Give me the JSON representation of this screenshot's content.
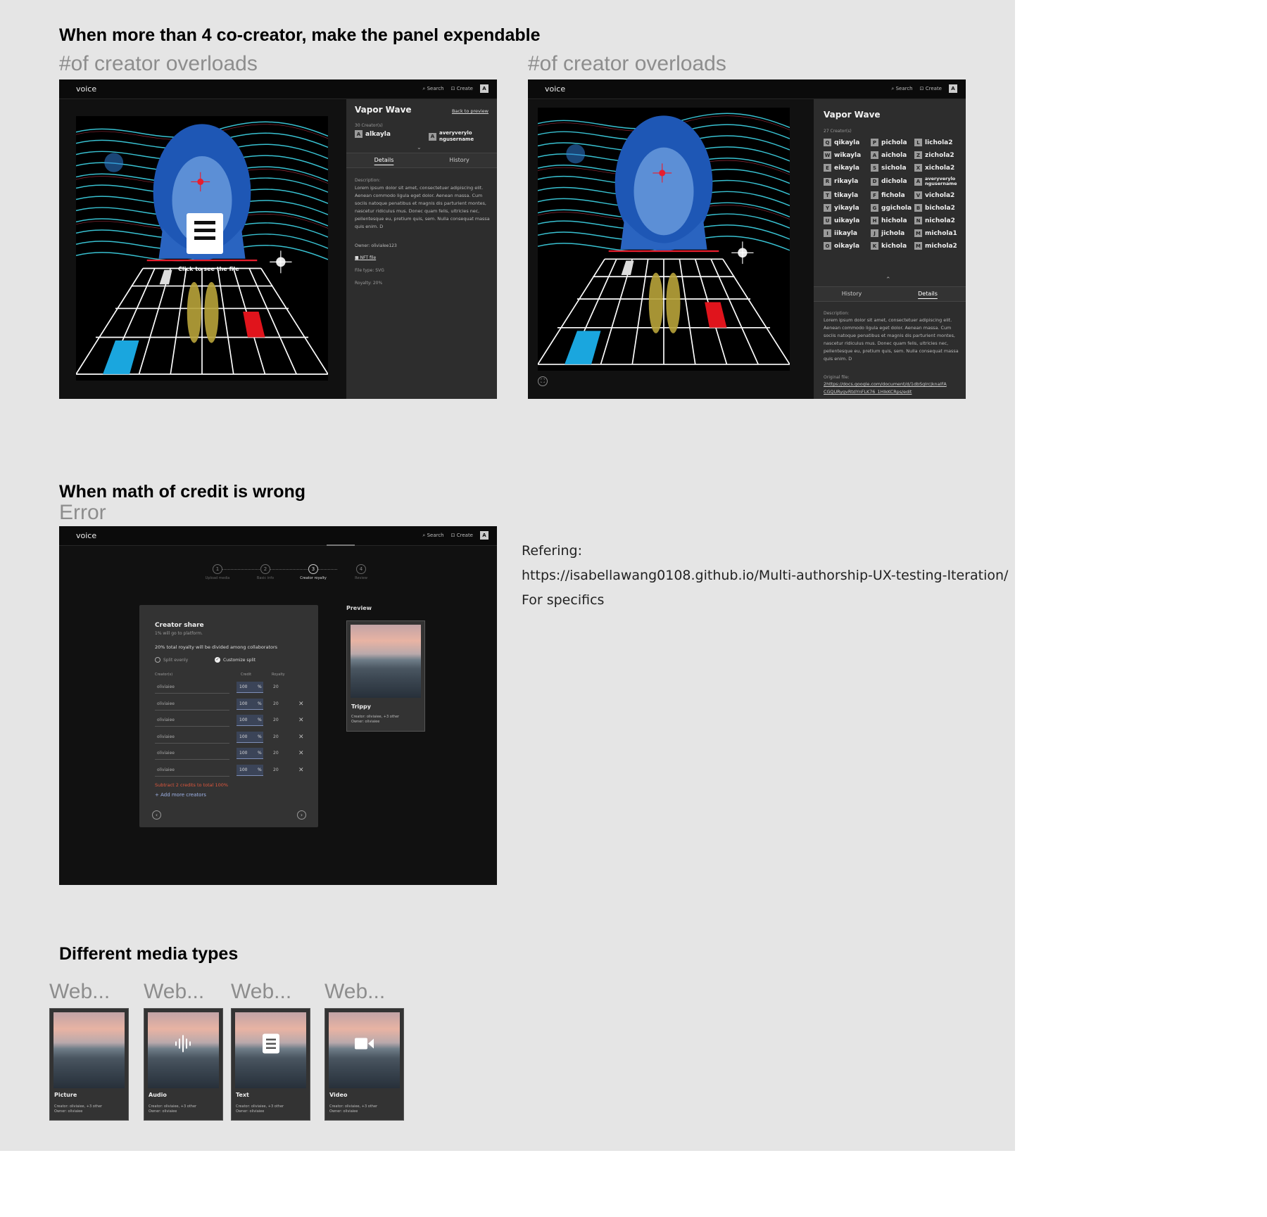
{
  "sections": {
    "expand_title": "When more than 4 co-creator, make the panel expendable",
    "overload_label_1": "#of creator overloads",
    "overload_label_2": "#of creator overloads",
    "error_title": "When math of credit is wrong",
    "error_label": "Error",
    "media_title": "Different media types"
  },
  "app": {
    "logo": "voice",
    "search": "Search",
    "create": "Create",
    "avatar": "A"
  },
  "frame1": {
    "title": "Vapor Wave",
    "back": "Back to preview",
    "creators_count": "30 Creator(s)",
    "creator_a": "alkayla",
    "creator_b": "averyverylo ngusername",
    "tab_details": "Details",
    "tab_history": "History",
    "desc_label": "Description:",
    "desc": "Lorem ipsum dolor sit amet, consectetuer adipiscing elit. Aenean commodo ligula eget dolor. Aenean massa. Cum sociis natoque penatibus et magnis dis parturient montes, nascetur ridiculus mus. Donec quam felis, ultricies nec, pellentesque eu, pretium quis, sem. Nulla consequat massa quis enim. D",
    "owner": "Owner: olivialee123",
    "nft_file": "NFT file",
    "file_type": "File type: SVG",
    "royalty": "Royalty: 20%",
    "overlay_caption": "Click to see the file"
  },
  "frame2": {
    "title": "Vapor Wave",
    "creators_count": "27 Creator(s)",
    "creators": [
      {
        "b": "Q",
        "n": "qikayla"
      },
      {
        "b": "P",
        "n": "pichola"
      },
      {
        "b": "L",
        "n": "lichola2"
      },
      {
        "b": "W",
        "n": "wikayla"
      },
      {
        "b": "A",
        "n": "aichola"
      },
      {
        "b": "Z",
        "n": "zichola2"
      },
      {
        "b": "E",
        "n": "eikayla"
      },
      {
        "b": "S",
        "n": "sichola"
      },
      {
        "b": "X",
        "n": "xichola2"
      },
      {
        "b": "R",
        "n": "rikayla"
      },
      {
        "b": "D",
        "n": "dichola"
      },
      {
        "b": "A",
        "n": "averyverylo ngusername"
      },
      {
        "b": "T",
        "n": "tikayla"
      },
      {
        "b": "F",
        "n": "fichola"
      },
      {
        "b": "V",
        "n": "vichola2"
      },
      {
        "b": "Y",
        "n": "yikayla"
      },
      {
        "b": "G",
        "n": "ggichola"
      },
      {
        "b": "B",
        "n": "bichola2"
      },
      {
        "b": "U",
        "n": "uikayla"
      },
      {
        "b": "H",
        "n": "hichola"
      },
      {
        "b": "N",
        "n": "nichola2"
      },
      {
        "b": "I",
        "n": "iikayla"
      },
      {
        "b": "J",
        "n": "jichola"
      },
      {
        "b": "M",
        "n": "michola1"
      },
      {
        "b": "O",
        "n": "oikayla"
      },
      {
        "b": "K",
        "n": "kichola"
      },
      {
        "b": "M",
        "n": "michola2"
      }
    ],
    "tab_history": "History",
    "tab_details": "Details",
    "desc_label": "Description:",
    "desc": "Lorem ipsum dolor sit amet, consectetuer adipiscing elit. Aenean commodo ligula eget dolor. Aenean massa. Cum sociis natoque penatibus et magnis dis parturient montes, nascetur ridiculus mus. Donec quam felis, ultricies nec, pellentesque eu, pretium quis, sem. Nulla consequat massa quis enim. D",
    "orig_label": "Original file:",
    "orig_link": "2https://docs.google.com/document/d/1dbSgIrcjknalFA CGQURygvRtdYnFLK76_1HlkKCRps/edit"
  },
  "frame3": {
    "steps": [
      {
        "n": "1",
        "label": "Upload media"
      },
      {
        "n": "2",
        "label": "Basic info"
      },
      {
        "n": "3",
        "label": "Creator royalty"
      },
      {
        "n": "4",
        "label": "Review"
      }
    ],
    "card_title": "Creator share",
    "card_sub": "1% will go to platform.",
    "royalty_note": "20% total royalty will be divided among collaborators",
    "opt_split": "Split evenly",
    "opt_custom": "Customize split",
    "col_creators": "Creator(s)",
    "col_credit": "Credit",
    "col_royalty": "Royalty",
    "rows": [
      {
        "name": "oliviaiee",
        "credit": "100",
        "pct": "%",
        "royalty": "20",
        "remove": ""
      },
      {
        "name": "oliviaiee",
        "credit": "100",
        "pct": "%",
        "royalty": "20",
        "remove": "✕"
      },
      {
        "name": "oliviaiee",
        "credit": "100",
        "pct": "%",
        "royalty": "20",
        "remove": "✕"
      },
      {
        "name": "oliviaiee",
        "credit": "100",
        "pct": "%",
        "royalty": "20",
        "remove": "✕"
      },
      {
        "name": "oliviaiee",
        "credit": "100",
        "pct": "%",
        "royalty": "20",
        "remove": "✕"
      },
      {
        "name": "oliviaiee",
        "credit": "100",
        "pct": "%",
        "royalty": "20",
        "remove": "✕"
      }
    ],
    "error": "Subtract 2 credits to total 100%",
    "add_more": "+ Add more creators",
    "preview_label": "Preview",
    "preview_title": "Trippy",
    "preview_creator": "Creator: oliviaiee, +3 other",
    "preview_owner": "Owner: oliviaiee"
  },
  "notes": {
    "line1": "Refering:",
    "line2": "https://isabellawang0108.github.io/Multi-authorship-UX-testing-Iteration/",
    "line3": "For specifics"
  },
  "media": [
    {
      "label": "Web...",
      "title": "Picture",
      "creator": "Creator: oliviaiee, +3 other",
      "owner": "Owner: oliviaiee",
      "icon": "none"
    },
    {
      "label": "Web...",
      "title": "Audio",
      "creator": "Creator: oliviaiee, +3 other",
      "owner": "Owner: oliviaiee",
      "icon": "audio-waveform-icon"
    },
    {
      "label": "Web...",
      "title": "Text",
      "creator": "Creator: oliviaiee, +3 other",
      "owner": "Owner: oliviaiee",
      "icon": "document-icon"
    },
    {
      "label": "Web...",
      "title": "Video",
      "creator": "Creator: oliviaiee, +3 other",
      "owner": "Owner: oliviaiee",
      "icon": "video-camera-icon"
    }
  ],
  "colors": {
    "canvas": "#e5e5e5",
    "app_bg": "#111111",
    "panel": "#2d2d2d",
    "error": "#e0573d",
    "accent_blue": "#7e8fb8"
  }
}
